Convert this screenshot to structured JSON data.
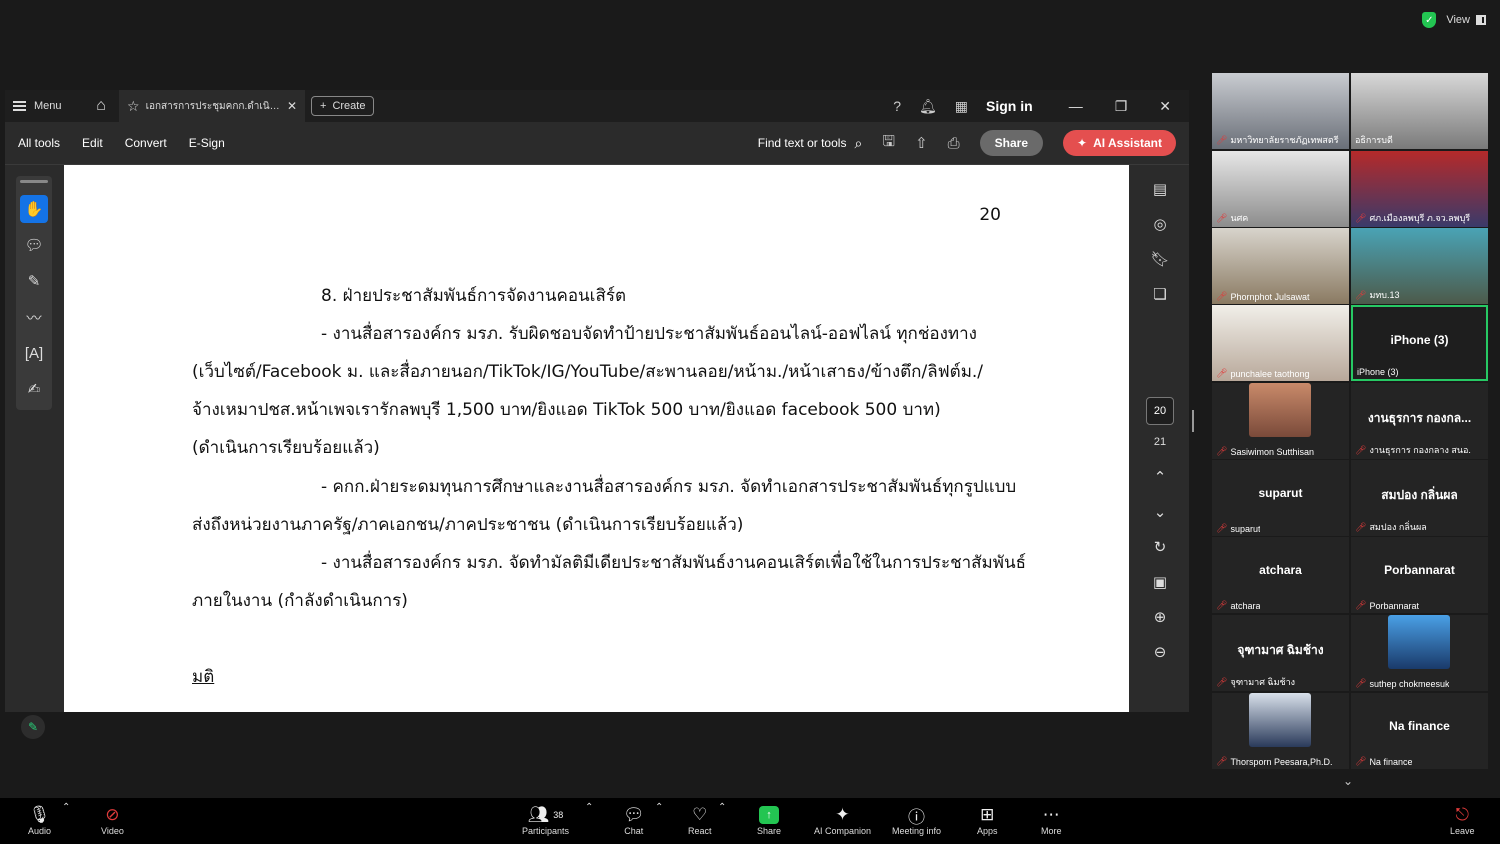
{
  "zoom": {
    "view_label": "View"
  },
  "acrobat": {
    "menu_label": "Menu",
    "tab_title": "เอกสารการประชุมคกก.ดำเนินง...",
    "create_label": "Create",
    "signin_label": "Sign in",
    "tools": [
      "All tools",
      "Edit",
      "Convert",
      "E-Sign"
    ],
    "find_label": "Find text or tools",
    "share_label": "Share",
    "ai_label": "AI Assistant",
    "current_page": "20",
    "total_pages": "21"
  },
  "document": {
    "page_number": "20",
    "lines": [
      "8. ฝ่ายประชาสัมพันธ์การจัดงานคอนเสิร์ต",
      "- งานสื่อสารองค์กร มรภ. รับผิดชอบจัดทำป้ายประชาสัมพันธ์ออนไลน์-ออฟไลน์ ทุกช่องทาง",
      "(เว็บไซต์/Facebook ม. และสื่อภายนอก/TikTok/IG/YouTube/สะพานลอย/หน้าม./หน้าเสาธง/ข้างตึก/ลิฟต์ม./",
      "จ้างเหมาปชส.หน้าเพจเรารักลพบุรี 1,500 บาท/ยิงแอด TikTok 500 บาท/ยิงแอด facebook 500 บาท)",
      "(ดำเนินการเรียบร้อยแล้ว)",
      "- คกก.ฝ่ายระดมทุนการศึกษาและงานสื่อสารองค์กร มรภ. จัดทำเอกสารประชาสัมพันธ์ทุกรูปแบบ",
      "ส่งถึงหน่วยงานภาครัฐ/ภาคเอกชน/ภาคประชาชน (ดำเนินการเรียบร้อยแล้ว)",
      "- งานสื่อสารองค์กร มรภ. จัดทำมัลติมีเดียประชาสัมพันธ์งานคอนเสิร์ตเพื่อใช้ในการประชาสัมพันธ์",
      "ภายในงาน (กำลังดำเนินการ)",
      "มติ"
    ]
  },
  "participants": [
    {
      "name": "มหาวิทยาลัยราชภัฏเทพสตรี",
      "video": true,
      "label": ""
    },
    {
      "name": "อธิการบดี",
      "video": true,
      "label": ""
    },
    {
      "name": "นศค",
      "video": true,
      "label": ""
    },
    {
      "name": "ศภ.เมืองลพบุรี ภ.จว.ลพบุรี",
      "video": true,
      "label": ""
    },
    {
      "name": "Phornphot Julsawat",
      "video": true,
      "label": ""
    },
    {
      "name": "มทบ.13",
      "video": true,
      "label": ""
    },
    {
      "name": "punchalee taothong",
      "video": true,
      "label": ""
    },
    {
      "name": "iPhone (3)",
      "video": false,
      "label": "iPhone (3)"
    },
    {
      "name": "Sasiwimon Sutthisan",
      "video": false,
      "label": ""
    },
    {
      "name": "งานธุรการ กองกลาง สนอ.",
      "video": false,
      "label": "งานธุรการ กองกล..."
    },
    {
      "name": "suparut",
      "video": false,
      "label": "suparut"
    },
    {
      "name": "สมปอง กลิ่นผล",
      "video": false,
      "label": "สมปอง กลิ่นผล"
    },
    {
      "name": "atchara",
      "video": false,
      "label": "atchara"
    },
    {
      "name": "Porbannarat",
      "video": false,
      "label": "Porbannarat"
    },
    {
      "name": "จุฑามาศ ฉิมช้าง",
      "video": false,
      "label": "จุฑามาศ ฉิมช้าง"
    },
    {
      "name": "suthep chokmeesuk",
      "video": false,
      "label": ""
    },
    {
      "name": "Thorsporn Peesara,Ph.D.",
      "video": false,
      "label": ""
    },
    {
      "name": "Na finance",
      "video": false,
      "label": "Na finance"
    }
  ],
  "controls": {
    "audio": "Audio",
    "video": "Video",
    "participants": "Participants",
    "participants_count": "38",
    "chat": "Chat",
    "react": "React",
    "share": "Share",
    "ai_companion": "AI Companion",
    "meeting_info": "Meeting info",
    "apps": "Apps",
    "more": "More",
    "leave": "Leave"
  }
}
